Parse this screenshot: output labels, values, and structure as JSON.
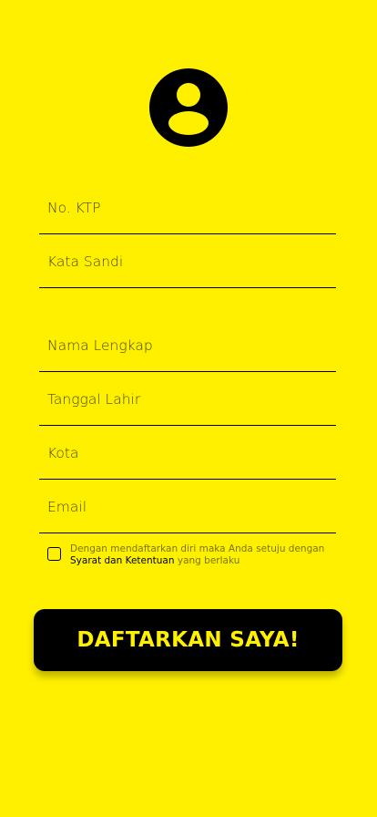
{
  "colors": {
    "background": "#FFF000",
    "accent": "#000000",
    "button_text": "#FFF000"
  },
  "avatar": {
    "icon": "account-circle-icon"
  },
  "login_fields": [
    {
      "placeholder": "No. KTP"
    },
    {
      "placeholder": "Kata Sandi"
    }
  ],
  "profile_fields": [
    {
      "placeholder": "Nama Lengkap"
    },
    {
      "placeholder": "Tanggal Lahir"
    },
    {
      "placeholder": "Kota"
    },
    {
      "placeholder": "Email"
    }
  ],
  "agreement": {
    "prefix": "Dengan mendaftarkan diri maka Anda setuju dengan",
    "link": "Syarat dan Ketentuan",
    "suffix": "yang berlaku"
  },
  "submit": {
    "label": "DAFTARKAN SAYA!"
  }
}
